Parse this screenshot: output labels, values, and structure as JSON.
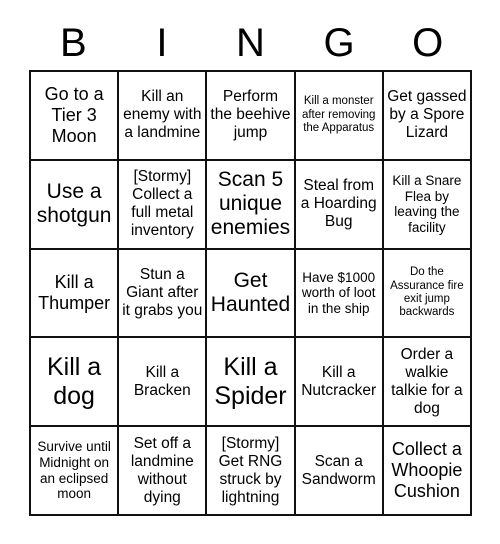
{
  "card": {
    "title": "BINGO",
    "header_letters": [
      "B",
      "I",
      "N",
      "G",
      "O"
    ],
    "grid_size": "5x5",
    "border_color": "#111111",
    "background_color": "#ffffff",
    "text_color": "#000000"
  },
  "rows": [
    {
      "cells": [
        {
          "text": "Go to a Tier 3 Moon",
          "size": "lg"
        },
        {
          "text": "Kill an enemy with a landmine",
          "size": "md"
        },
        {
          "text": "Perform the beehive jump",
          "size": "md"
        },
        {
          "text": "Kill a monster after removing the Apparatus",
          "size": "xs"
        },
        {
          "text": "Get gassed by a Spore Lizard",
          "size": "md"
        }
      ]
    },
    {
      "cells": [
        {
          "text": "Use a shotgun",
          "size": "xl"
        },
        {
          "text": "[Stormy] Collect a full metal inventory",
          "size": "md"
        },
        {
          "text": "Scan 5 unique enemies",
          "size": "xl"
        },
        {
          "text": "Steal from a Hoarding Bug",
          "size": "md"
        },
        {
          "text": "Kill a Snare Flea by leaving the facility",
          "size": "sm"
        }
      ]
    },
    {
      "cells": [
        {
          "text": "Kill a Thumper",
          "size": "lg"
        },
        {
          "text": "Stun a Giant after it grabs you",
          "size": "md"
        },
        {
          "text": "Get Haunted",
          "size": "xl"
        },
        {
          "text": "Have $1000 worth of loot in the ship",
          "size": "sm"
        },
        {
          "text": "Do the Assurance fire exit jump backwards",
          "size": "xs"
        }
      ]
    },
    {
      "cells": [
        {
          "text": "Kill a dog",
          "size": "xxl"
        },
        {
          "text": "Kill a Bracken",
          "size": "md"
        },
        {
          "text": "Kill a Spider",
          "size": "xxl"
        },
        {
          "text": "Kill a Nutcracker",
          "size": "md"
        },
        {
          "text": "Order a walkie talkie for a dog",
          "size": "md"
        }
      ]
    },
    {
      "cells": [
        {
          "text": "Survive until Midnight on an eclipsed moon",
          "size": "sm"
        },
        {
          "text": "Set off a landmine without dying",
          "size": "md"
        },
        {
          "text": "[Stormy] Get RNG struck by lightning",
          "size": "md"
        },
        {
          "text": "Scan a Sandworm",
          "size": "md"
        },
        {
          "text": "Collect a Whoopie Cushion",
          "size": "lg"
        }
      ]
    }
  ]
}
